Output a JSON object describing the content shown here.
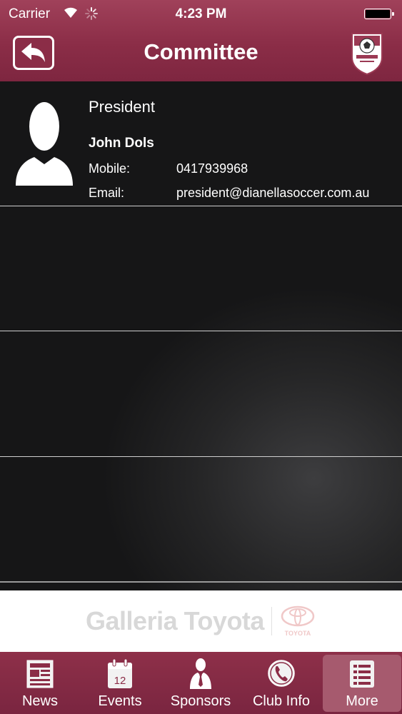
{
  "status_bar": {
    "carrier": "Carrier",
    "time": "4:23 PM"
  },
  "nav": {
    "title": "Committee",
    "back_icon": "back-arrow-icon",
    "logo_icon": "club-crest-icon"
  },
  "members": [
    {
      "role": "President",
      "name": "John Dols",
      "mobile_label": "Mobile:",
      "mobile": "0417939968",
      "email_label": "Email:",
      "email": "president@dianellasoccer.com.au"
    }
  ],
  "sponsor": {
    "name": "Galleria Toyota",
    "logo_text": "TOYOTA"
  },
  "tabs": [
    {
      "label": "News",
      "icon": "newspaper-icon"
    },
    {
      "label": "Events",
      "icon": "calendar-icon",
      "badge": "12"
    },
    {
      "label": "Sponsors",
      "icon": "person-suit-icon"
    },
    {
      "label": "Club Info",
      "icon": "phone-icon"
    },
    {
      "label": "More",
      "icon": "list-icon",
      "selected": true
    }
  ],
  "colors": {
    "brand": "#8b2d47",
    "tab_selected": "#a65a6e",
    "background": "#161617"
  }
}
